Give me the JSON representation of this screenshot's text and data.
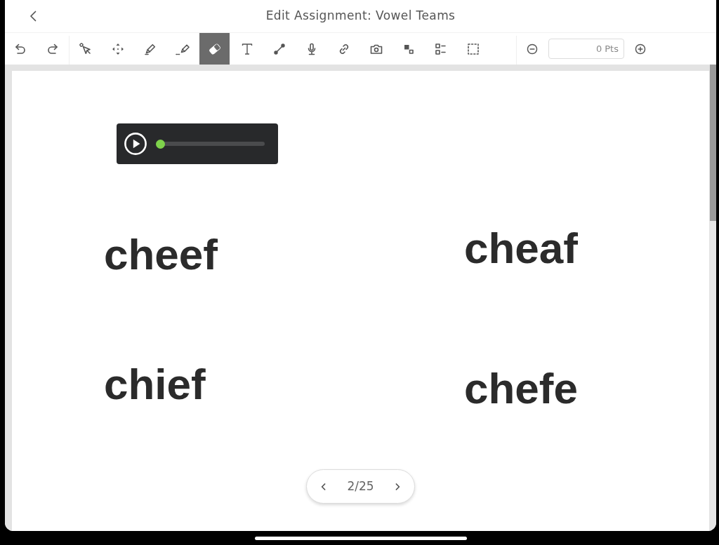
{
  "header": {
    "title": "Edit Assignment: Vowel Teams"
  },
  "toolbar": {
    "history": [
      {
        "kind": "undo"
      },
      {
        "kind": "redo"
      }
    ],
    "tools": [
      {
        "kind": "select",
        "selected": false
      },
      {
        "kind": "move",
        "selected": false
      },
      {
        "kind": "pen",
        "selected": false
      },
      {
        "kind": "highlighter",
        "selected": false
      },
      {
        "kind": "eraser",
        "selected": true
      },
      {
        "kind": "text",
        "selected": false
      },
      {
        "kind": "line",
        "selected": false
      },
      {
        "kind": "microphone",
        "selected": false
      },
      {
        "kind": "link",
        "selected": false
      },
      {
        "kind": "camera",
        "selected": false
      },
      {
        "kind": "shapes",
        "selected": false
      },
      {
        "kind": "checklist",
        "selected": false
      },
      {
        "kind": "marquee",
        "selected": false
      }
    ],
    "points": {
      "value": "0 Pts"
    }
  },
  "canvas": {
    "audio_player": {
      "level": 0
    },
    "words": [
      "cheef",
      "cheaf",
      "chief",
      "chefe"
    ]
  },
  "pager": {
    "page": "2/25"
  }
}
